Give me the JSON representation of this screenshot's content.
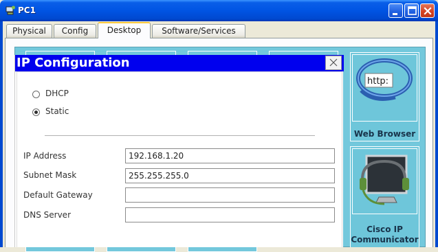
{
  "window": {
    "title": "PC1"
  },
  "tabs": [
    {
      "label": "Physical"
    },
    {
      "label": "Config"
    },
    {
      "label": "Desktop"
    },
    {
      "label": "Software/Services"
    }
  ],
  "desktop": {
    "apps": [
      {
        "label": "Web Browser",
        "icon": "web-browser-icon",
        "icon_text": "http:"
      },
      {
        "label": "Cisco IP Communicator",
        "icon": "ip-communicator-icon"
      }
    ]
  },
  "ip_dialog": {
    "title": "IP Configuration",
    "mode_options": [
      {
        "label": "DHCP",
        "selected": false
      },
      {
        "label": "Static",
        "selected": true
      }
    ],
    "fields": {
      "ip_address": {
        "label": "IP Address",
        "value": "192.168.1.20"
      },
      "subnet_mask": {
        "label": "Subnet Mask",
        "value": "255.255.255.0"
      },
      "default_gateway": {
        "label": "Default Gateway",
        "value": ""
      },
      "dns_server": {
        "label": "DNS Server",
        "value": ""
      }
    }
  },
  "colors": {
    "titlebar": "#0054e3",
    "dialog_titlebar": "#0000ee",
    "desktop_bg": "#73c8dc",
    "active_tab_highlight": "#ffc73c"
  }
}
